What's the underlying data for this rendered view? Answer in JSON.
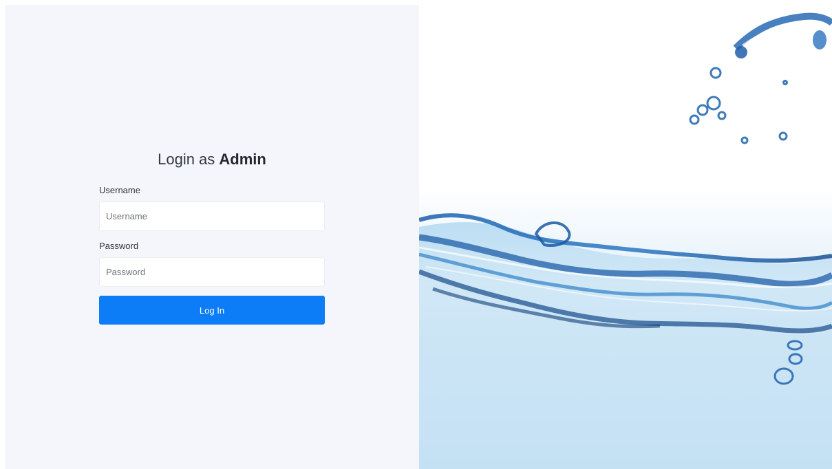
{
  "login": {
    "title_prefix": "Login as",
    "title_emphasis": "Admin",
    "username_label": "Username",
    "username_placeholder": "Username",
    "password_label": "Password",
    "password_placeholder": "Password",
    "submit_label": "Log In"
  },
  "colors": {
    "panel_bg": "#f4f6fb",
    "primary": "#0d7df7",
    "water_dark": "#1a4f93",
    "water_light": "#c2e0f3"
  }
}
